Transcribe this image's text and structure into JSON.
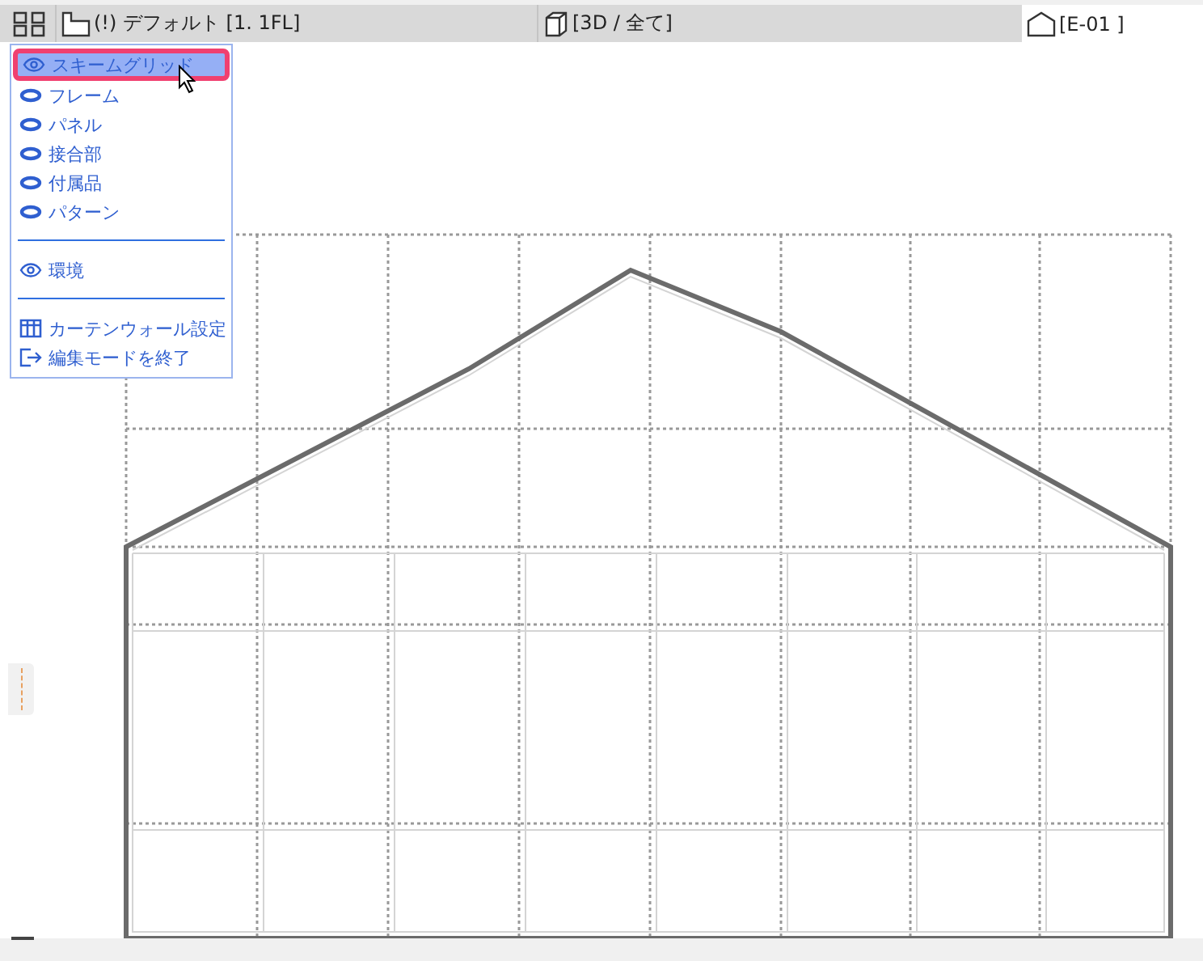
{
  "tabs": [
    {
      "kind": "plan",
      "label": "(!) デフォルト [1. 1FL]",
      "selected": false
    },
    {
      "kind": "perspective",
      "label": "[3D / 全て]",
      "selected": false
    },
    {
      "kind": "elevation",
      "label": "[E-01 ]",
      "selected": true
    }
  ],
  "menu": {
    "items": [
      {
        "kind": "eye",
        "label": "スキームグリッド",
        "selected": true
      },
      {
        "kind": "oval",
        "label": "フレーム",
        "selected": false
      },
      {
        "kind": "oval",
        "label": "パネル",
        "selected": false
      },
      {
        "kind": "oval",
        "label": "接合部",
        "selected": false
      },
      {
        "kind": "oval",
        "label": "付属品",
        "selected": false
      },
      {
        "kind": "oval",
        "label": "パターン",
        "selected": false
      },
      {
        "kind": "separator"
      },
      {
        "kind": "eye",
        "label": "環境",
        "selected": false
      },
      {
        "kind": "separator"
      },
      {
        "kind": "settings",
        "label": "カーテンウォール設定",
        "selected": false
      },
      {
        "kind": "exit",
        "label": "編集モードを終了",
        "selected": false
      }
    ]
  }
}
